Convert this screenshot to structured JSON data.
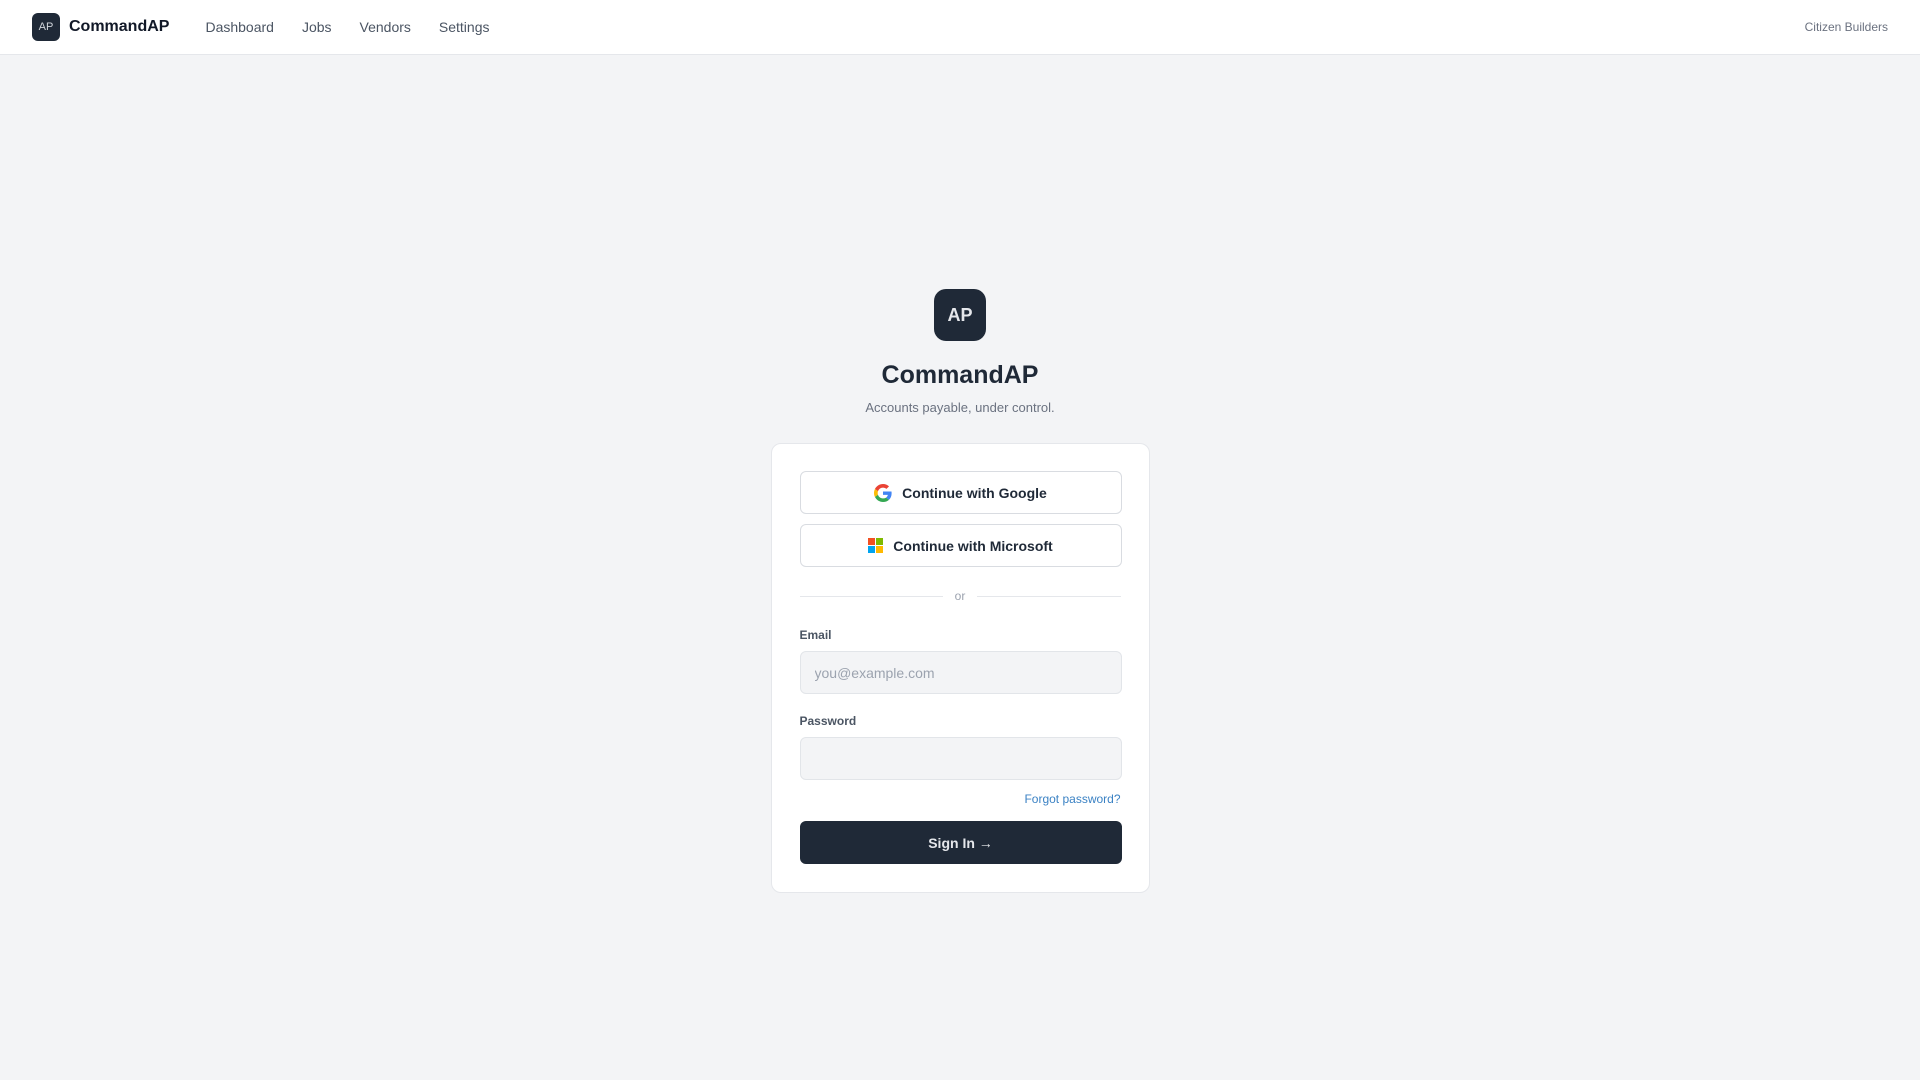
{
  "header": {
    "brand_badge": "AP",
    "brand_name": "CommandAP",
    "nav": [
      {
        "label": "Dashboard"
      },
      {
        "label": "Jobs"
      },
      {
        "label": "Vendors"
      },
      {
        "label": "Settings"
      }
    ],
    "org_name": "Citizen Builders"
  },
  "hero": {
    "badge": "AP",
    "title": "CommandAP",
    "subtitle": "Accounts payable, under control."
  },
  "auth": {
    "google_label": "Continue with Google",
    "microsoft_label": "Continue with Microsoft",
    "divider_text": "or",
    "email_label": "Email",
    "email_placeholder": "you@example.com",
    "email_value": "",
    "password_label": "Password",
    "password_value": "",
    "forgot_label": "Forgot password?",
    "signin_label": "Sign In →"
  },
  "colors": {
    "primary_dark": "#1f2937",
    "link_blue": "#3b82c4",
    "background": "#f3f4f6"
  },
  "icons": {
    "google": "google-icon",
    "microsoft": "microsoft-icon"
  }
}
